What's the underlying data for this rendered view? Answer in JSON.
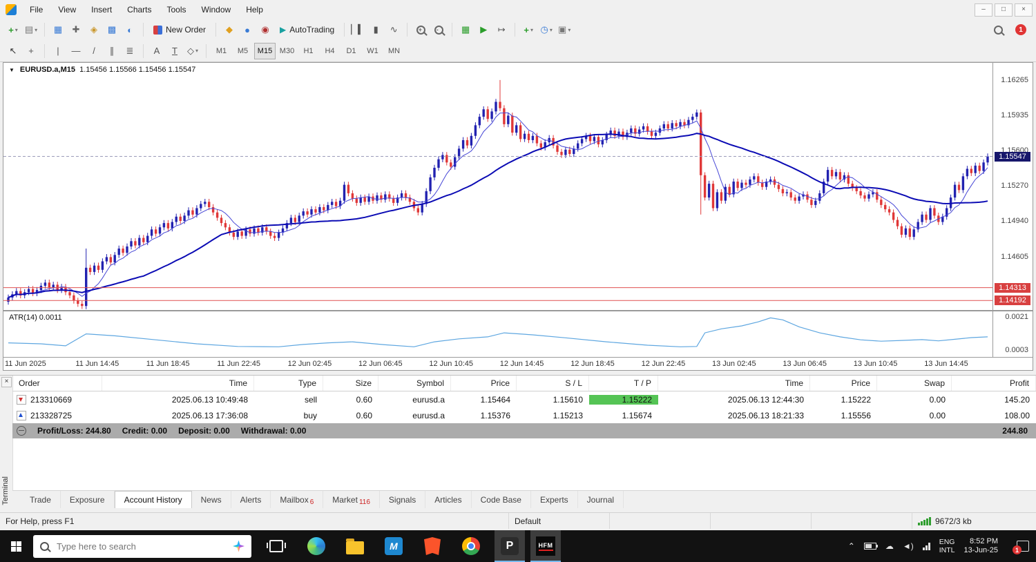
{
  "menu": {
    "items": [
      "File",
      "View",
      "Insert",
      "Charts",
      "Tools",
      "Window",
      "Help"
    ]
  },
  "toolbar": {
    "new_order_label": "New Order",
    "autotrading_label": "AutoTrading",
    "notification_count": "1",
    "timeframes": [
      "M1",
      "M5",
      "M15",
      "M30",
      "H1",
      "H4",
      "D1",
      "W1",
      "MN"
    ],
    "active_timeframe": "M15"
  },
  "chart": {
    "symbol_title": "EURUSD.a,M15",
    "ohlc": "1.15456 1.15566 1.15456 1.15547",
    "price_labels": [
      "1.16265",
      "1.15935",
      "1.15600",
      "1.15270",
      "1.14940",
      "1.14605"
    ],
    "current_price": "1.15547",
    "level_prices": [
      "1.14313",
      "1.14192"
    ],
    "atr_label": "ATR(14) 0.0011",
    "atr_max": "0.0021",
    "atr_min": "0.0003",
    "time_labels": [
      "11 Jun 2025",
      "11 Jun 14:45",
      "11 Jun 18:45",
      "11 Jun 22:45",
      "12 Jun 02:45",
      "12 Jun 06:45",
      "12 Jun 10:45",
      "12 Jun 14:45",
      "12 Jun 18:45",
      "12 Jun 22:45",
      "13 Jun 02:45",
      "13 Jun 06:45",
      "13 Jun 10:45",
      "13 Jun 14:45"
    ]
  },
  "chart_data": {
    "type": "candlestick",
    "symbol": "EURUSD.a",
    "timeframe": "M15",
    "price_range": [
      1.141,
      1.1643
    ],
    "atr_range": [
      0.0003,
      0.0021
    ],
    "closes": [
      1.1422,
      1.1425,
      1.1428,
      1.1424,
      1.1427,
      1.143,
      1.1426,
      1.1429,
      1.1433,
      1.1436,
      1.1431,
      1.1434,
      1.1429,
      1.1432,
      1.1427,
      1.1424,
      1.1419,
      1.1416,
      1.1414,
      1.145,
      1.1446,
      1.1452,
      1.1448,
      1.1456,
      1.146,
      1.1455,
      1.1462,
      1.1468,
      1.1464,
      1.147,
      1.1475,
      1.1471,
      1.1478,
      1.1474,
      1.148,
      1.1486,
      1.1482,
      1.1488,
      1.1492,
      1.1487,
      1.1493,
      1.1498,
      1.1494,
      1.1499,
      1.1504,
      1.15,
      1.1506,
      1.151,
      1.1512,
      1.1507,
      1.1502,
      1.1497,
      1.1492,
      1.1488,
      1.1483,
      1.1479,
      1.1484,
      1.148,
      1.1486,
      1.1482,
      1.1487,
      1.1483,
      1.1488,
      1.1484,
      1.148,
      1.1478,
      1.1483,
      1.1487,
      1.1492,
      1.1497,
      1.1493,
      1.1499,
      1.1503,
      1.15,
      1.1505,
      1.1502,
      1.1507,
      1.1504,
      1.1509,
      1.1512,
      1.1508,
      1.1513,
      1.1528,
      1.152,
      1.1515,
      1.1511,
      1.1516,
      1.1512,
      1.1517,
      1.1513,
      1.1518,
      1.1514,
      1.1519,
      1.1515,
      1.1511,
      1.1516,
      1.152,
      1.1516,
      1.1512,
      1.1506,
      1.1502,
      1.151,
      1.1522,
      1.1535,
      1.1544,
      1.1552,
      1.1556,
      1.1549,
      1.1545,
      1.1554,
      1.1562,
      1.157,
      1.1565,
      1.1574,
      1.1584,
      1.1592,
      1.1599,
      1.159,
      1.1597,
      1.1606,
      1.16,
      1.1585,
      1.1593,
      1.1577,
      1.1584,
      1.1571,
      1.1576,
      1.157,
      1.1574,
      1.1567,
      1.1563,
      1.1568,
      1.1572,
      1.1565,
      1.1559,
      1.1556,
      1.1561,
      1.1557,
      1.1562,
      1.1567,
      1.1571,
      1.1574,
      1.1569,
      1.1573,
      1.1566,
      1.157,
      1.1575,
      1.1579,
      1.1574,
      1.1578,
      1.1573,
      1.1577,
      1.1581,
      1.1576,
      1.158,
      1.1583,
      1.1578,
      1.1574,
      1.1577,
      1.1581,
      1.1585,
      1.1581,
      1.1586,
      1.1583,
      1.1587,
      1.1584,
      1.1589,
      1.1592,
      1.1596,
      1.1537,
      1.1516,
      1.1529,
      1.1506,
      1.1521,
      1.1513,
      1.1526,
      1.1519,
      1.1531,
      1.1525,
      1.153,
      1.1528,
      1.1533,
      1.1536,
      1.153,
      1.1526,
      1.1531,
      1.1533,
      1.1528,
      1.1524,
      1.152,
      1.1521,
      1.1516,
      1.1513,
      1.1517,
      1.1519,
      1.1514,
      1.1509,
      1.1513,
      1.152,
      1.1531,
      1.1542,
      1.1536,
      1.154,
      1.1533,
      1.1537,
      1.1529,
      1.1525,
      1.1522,
      1.1518,
      1.1515,
      1.1519,
      1.1521,
      1.1514,
      1.1509,
      1.1505,
      1.1502,
      1.1495,
      1.1489,
      1.1481,
      1.1487,
      1.1479,
      1.1486,
      1.1493,
      1.15,
      1.1495,
      1.1506,
      1.1499,
      1.1493,
      1.1498,
      1.1506,
      1.1516,
      1.1528,
      1.1523,
      1.1536,
      1.1543,
      1.1539,
      1.1546,
      1.1541,
      1.1549,
      1.15547
    ],
    "overrides": [
      {
        "i": 19,
        "h": 1.1468,
        "l": 1.1411
      },
      {
        "i": 120,
        "h": 1.16265
      },
      {
        "i": 169,
        "l": 1.15
      }
    ],
    "atr_points": [
      [
        0,
        0.0008
      ],
      [
        8,
        0.00075
      ],
      [
        14,
        0.00065
      ],
      [
        19,
        0.00125
      ],
      [
        26,
        0.00115
      ],
      [
        36,
        0.00095
      ],
      [
        46,
        0.00075
      ],
      [
        56,
        0.00062
      ],
      [
        66,
        0.0006
      ],
      [
        72,
        0.00072
      ],
      [
        78,
        0.0008
      ],
      [
        84,
        0.00085
      ],
      [
        92,
        0.0007
      ],
      [
        99,
        0.0006
      ],
      [
        104,
        0.00085
      ],
      [
        110,
        0.001
      ],
      [
        117,
        0.0011
      ],
      [
        121,
        0.0013
      ],
      [
        128,
        0.0012
      ],
      [
        136,
        0.00105
      ],
      [
        146,
        0.00085
      ],
      [
        156,
        0.00068
      ],
      [
        164,
        0.0006
      ],
      [
        168,
        0.00062
      ],
      [
        170,
        0.0013
      ],
      [
        174,
        0.0015
      ],
      [
        179,
        0.00165
      ],
      [
        183,
        0.00185
      ],
      [
        186,
        0.00205
      ],
      [
        189,
        0.00195
      ],
      [
        193,
        0.0016
      ],
      [
        198,
        0.0013
      ],
      [
        203,
        0.0011
      ],
      [
        208,
        0.00095
      ],
      [
        213,
        0.00088
      ],
      [
        218,
        0.00092
      ],
      [
        223,
        0.00096
      ],
      [
        227,
        0.0009
      ],
      [
        231,
        0.00098
      ],
      [
        235,
        0.00106
      ],
      [
        239,
        0.0011
      ]
    ],
    "colors": {
      "up": "#2222b0",
      "down": "#e03838",
      "ma_fast": "#4646d6",
      "ma_slow": "#0b0bb4",
      "atr": "#5da6e0",
      "level": "#e05050",
      "current_badge": "#16166b",
      "level_badge": "#d84040",
      "tp_highlight": "#55c455"
    }
  },
  "terminal": {
    "side_label": "Terminal",
    "columns": [
      "Order",
      "Time",
      "Type",
      "Size",
      "Symbol",
      "Price",
      "S / L",
      "T / P",
      "Time",
      "Price",
      "Swap",
      "Profit"
    ],
    "rows": [
      {
        "order": "213310669",
        "time": "2025.06.13 10:49:48",
        "type": "sell",
        "size": "0.60",
        "symbol": "eurusd.a",
        "price": "1.15464",
        "sl": "1.15610",
        "tp": "1.15222",
        "close_time": "2025.06.13 12:44:30",
        "close_price": "1.15222",
        "swap": "0.00",
        "profit": "145.20"
      },
      {
        "order": "213328725",
        "time": "2025.06.13 17:36:08",
        "type": "buy",
        "size": "0.60",
        "symbol": "eurusd.a",
        "price": "1.15376",
        "sl": "1.15213",
        "tp": "1.15674",
        "close_time": "2025.06.13 18:21:33",
        "close_price": "1.15556",
        "swap": "0.00",
        "profit": "108.00"
      }
    ],
    "summary": {
      "items": [
        "Profit/Loss: 244.80",
        "Credit: 0.00",
        "Deposit: 0.00",
        "Withdrawal: 0.00"
      ],
      "total": "244.80"
    },
    "tabs": [
      {
        "label": "Trade"
      },
      {
        "label": "Exposure"
      },
      {
        "label": "Account History",
        "active": true
      },
      {
        "label": "News"
      },
      {
        "label": "Alerts"
      },
      {
        "label": "Mailbox",
        "badge": "6"
      },
      {
        "label": "Market",
        "badge": "116"
      },
      {
        "label": "Signals"
      },
      {
        "label": "Articles"
      },
      {
        "label": "Code Base"
      },
      {
        "label": "Experts"
      },
      {
        "label": "Journal"
      }
    ]
  },
  "statusbar": {
    "help_text": "For Help, press F1",
    "profile": "Default",
    "traffic": "9672/3 kb"
  },
  "taskbar": {
    "search_placeholder": "Type here to search",
    "language_line1": "ENG",
    "language_line2": "INTL",
    "clock_time": "8:52 PM",
    "clock_date": "13-Jun-25",
    "notification_count": "1"
  }
}
